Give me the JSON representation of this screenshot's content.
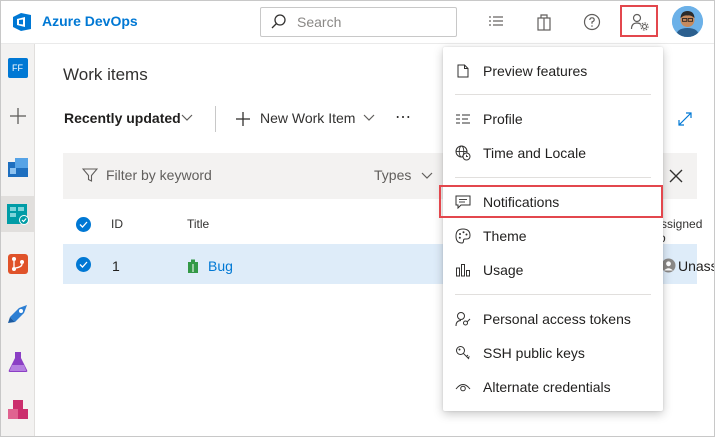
{
  "header": {
    "brand": "Azure DevOps",
    "search_placeholder": "Search"
  },
  "rail": {
    "project_badge": "FF"
  },
  "main": {
    "page_title": "Work items",
    "toolbar": {
      "view_label": "Recently updated",
      "new_item_label": "New Work Item",
      "more_label": "⋯"
    },
    "filter": {
      "placeholder": "Filter by keyword",
      "types_label": "Types"
    },
    "columns": {
      "id": "ID",
      "title": "Title",
      "assigned_to": "Assigned To"
    },
    "rows": [
      {
        "id": "1",
        "title": "Bug",
        "assigned_to": "Unassigned"
      }
    ]
  },
  "user_menu": {
    "items": [
      {
        "label": "Preview features",
        "icon": "page-icon"
      },
      {
        "label": "Profile",
        "icon": "profile-icon"
      },
      {
        "label": "Time and Locale",
        "icon": "globe-clock-icon"
      },
      {
        "label": "Notifications",
        "icon": "message-icon"
      },
      {
        "label": "Theme",
        "icon": "palette-icon"
      },
      {
        "label": "Usage",
        "icon": "chart-icon"
      },
      {
        "label": "Personal access tokens",
        "icon": "key-person-icon"
      },
      {
        "label": "SSH public keys",
        "icon": "ssh-key-icon"
      },
      {
        "label": "Alternate credentials",
        "icon": "eye-icon"
      }
    ]
  },
  "colors": {
    "accent": "#0078d4",
    "highlight": "#e3474d",
    "selected_row": "#deecf9",
    "bug": "#339947"
  }
}
